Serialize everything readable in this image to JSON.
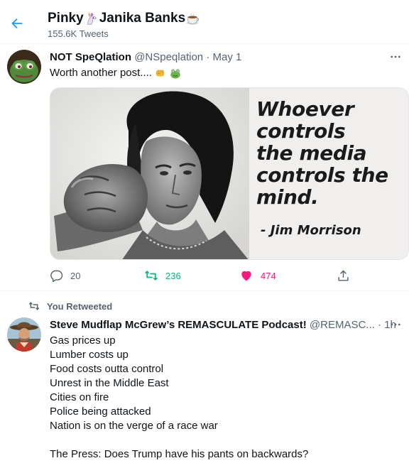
{
  "header": {
    "name_a": "Pinky",
    "name_b": "Janika Banks",
    "tweet_count": "155.6K Tweets",
    "icons": [
      "back-arrow-icon",
      "unicorn-emoji",
      "hot-beverage-emoji"
    ]
  },
  "tweet1": {
    "name": "NOT SpeQlation",
    "handle": "@NSpeqlation",
    "separator": "·",
    "time": "May 1",
    "text": "Worth another post....",
    "text_icons": [
      "oncoming-fist-emoji",
      "frog-emoji"
    ],
    "media": {
      "quote_lines": [
        "Whoever",
        "controls",
        "the media",
        "controls the",
        "mind."
      ],
      "author": "- Jim Morrison"
    },
    "actions": {
      "replies": "20",
      "retweets": "236",
      "likes": "474"
    }
  },
  "tweet2": {
    "retweet_label": "You Retweeted",
    "name": "Steve Mudflap McGrew’s REMASCULATE Podcast!",
    "handle": "@REMASC...",
    "separator": "·",
    "time": "1h",
    "lines": [
      "Gas prices up",
      "Lumber costs up",
      "Food costs outta control",
      "Unrest in the Middle East",
      "Cities on fire",
      "Police being attacked",
      "Nation is on the verge of a race war"
    ],
    "last_line": "The Press:  Does Trump have his pants on backwards?"
  },
  "colors": {
    "accent": "#1d9bf0",
    "retweet": "#00ba7c",
    "like": "#f91880",
    "secondary_text": "#536471"
  }
}
